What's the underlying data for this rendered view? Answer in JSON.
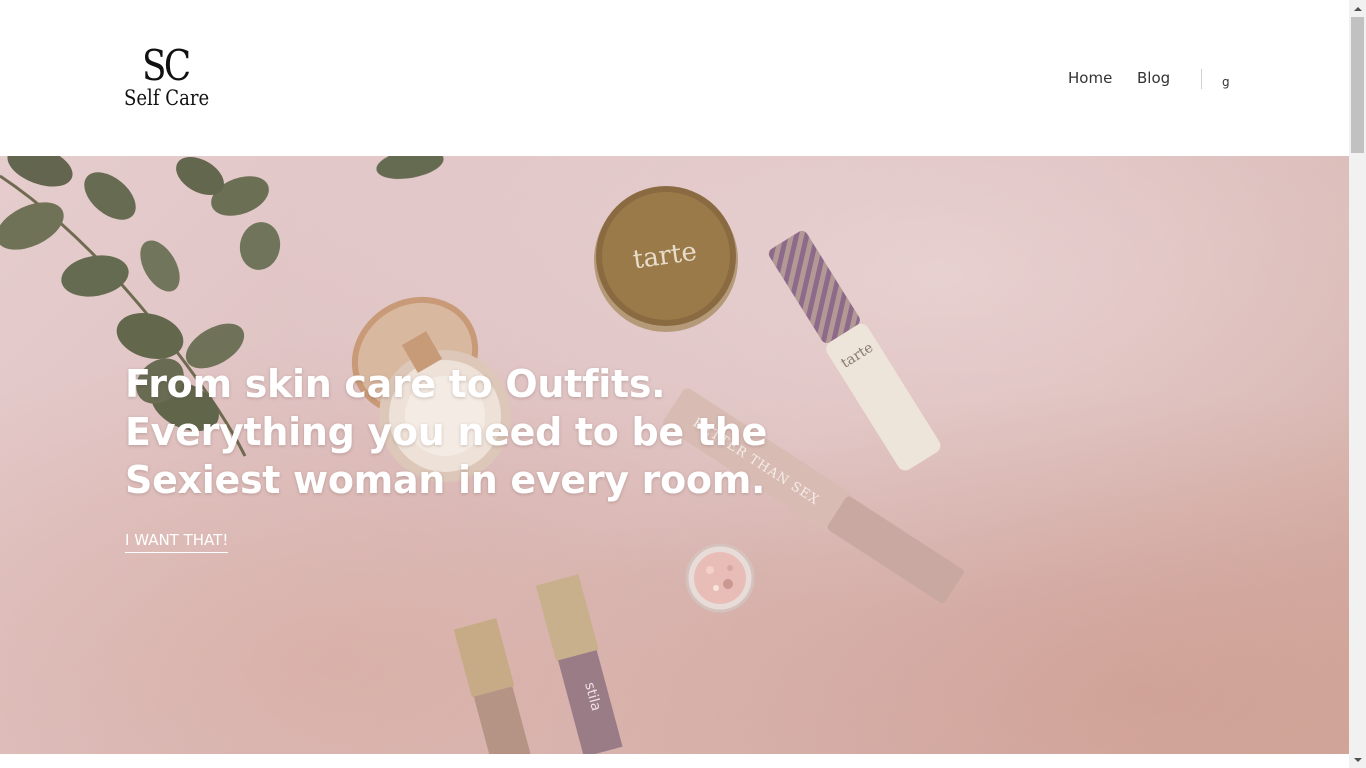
{
  "brand": {
    "mark": "SC",
    "name": "Self Care"
  },
  "nav": {
    "items": [
      {
        "label": "Home"
      },
      {
        "label": "Blog"
      }
    ],
    "extra_label": "g"
  },
  "hero": {
    "title_lines": [
      "From skin care to Outfits.",
      "Everything you need to be the",
      "Sexiest woman in every room."
    ],
    "cta_label": "I WANT THAT!",
    "image_description_icon": "makeup-flatlay-image"
  },
  "colors": {
    "header_bg": "#ffffff",
    "hero_text": "#ffffff",
    "nav_text": "#333333",
    "hero_bg": "#ddc0c1"
  }
}
